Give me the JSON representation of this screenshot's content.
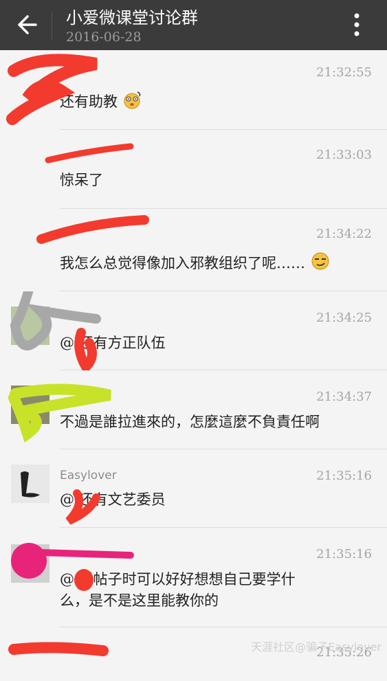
{
  "header": {
    "title": "小爱微课堂讨论群",
    "date": "2016-06-28",
    "back_icon": "back-arrow-icon",
    "more_icon": "more-vertical-icon"
  },
  "messages": [
    {
      "time": "21:32:55",
      "text": "还有助教"
    },
    {
      "time": "21:33:03",
      "text": "惊呆了"
    },
    {
      "time": "21:34:22",
      "text": "我怎么总觉得像加入邪教组织了呢……"
    },
    {
      "time": "21:34:25",
      "text": "@  还有方正队伍"
    },
    {
      "time": "21:34:37",
      "text": "不過是誰拉進來的，怎麼這麼不負責任啊"
    },
    {
      "sender": "Easylover",
      "time": "21:35:16",
      "text": "@  还有文艺委员"
    },
    {
      "time": "21:35:16",
      "text_line1": "@   看帖子时可以好好想想自己要学什",
      "text_line2": "么，是不是这里能教你的"
    },
    {
      "time": "21:35:26"
    }
  ],
  "watermark": "天涯社区@骗子Easylover",
  "colors": {
    "header": "#3b3b3b",
    "background": "#f4f4f4",
    "time": "#a4a4a4"
  }
}
